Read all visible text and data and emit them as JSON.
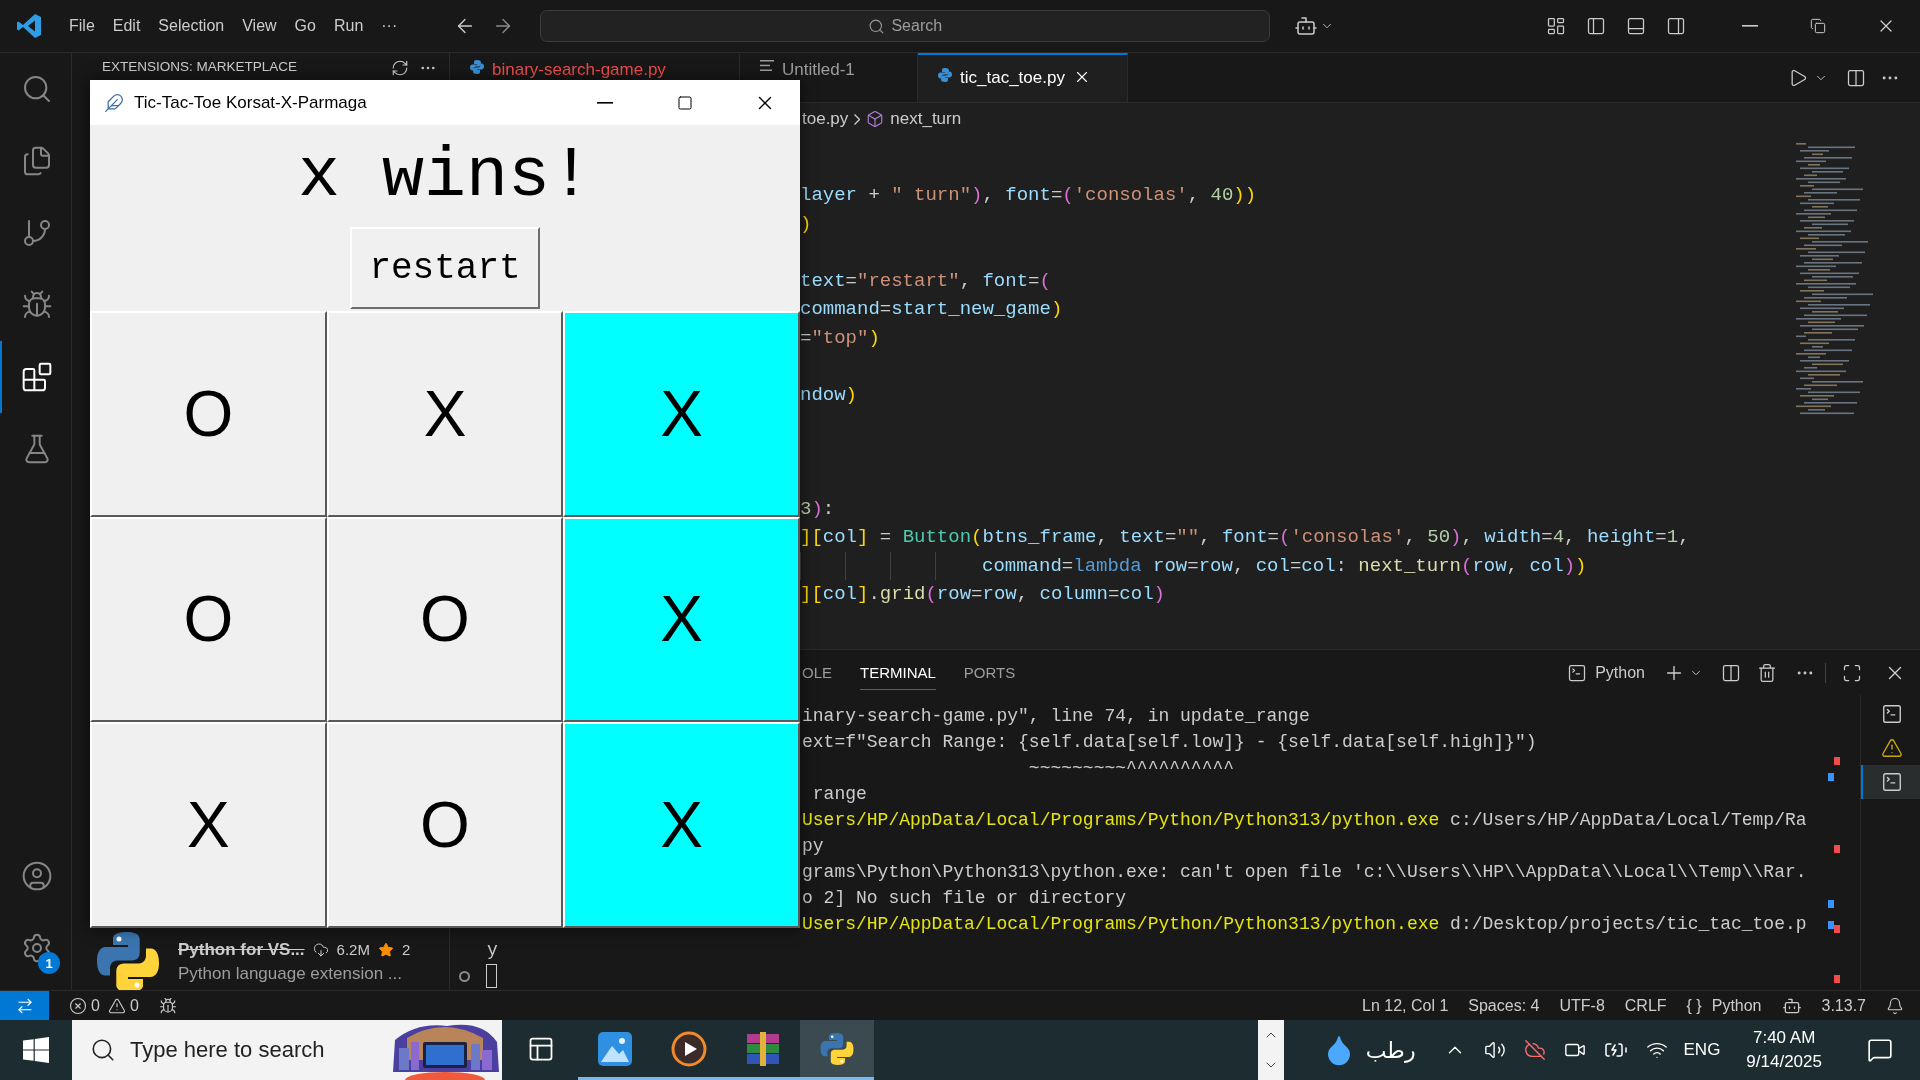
{
  "titlebar": {
    "menus": [
      "File",
      "Edit",
      "Selection",
      "View",
      "Go",
      "Run",
      "···"
    ],
    "search": {
      "placeholder": "Search"
    }
  },
  "activity_bar": {
    "items": [
      {
        "kind": "search",
        "selected": false
      },
      {
        "kind": "explorer",
        "selected": false
      },
      {
        "kind": "source-control",
        "selected": false
      },
      {
        "kind": "run",
        "selected": false
      },
      {
        "kind": "extensions",
        "selected": true
      },
      {
        "kind": "testing",
        "selected": false
      }
    ],
    "settings_badge": "1"
  },
  "sidebar": {
    "title": "EXTENSIONS: MARKETPLACE",
    "extension": {
      "name": "Python for VS...",
      "deprecated": true,
      "downloads": "6.2M",
      "rating": "2",
      "description": "Python language extension ..."
    }
  },
  "editor": {
    "tabs": [
      {
        "label": "binary-search-game.py",
        "kind": "python",
        "error": true,
        "selected": false
      },
      {
        "label": "Untitled-1",
        "kind": "text",
        "error": false,
        "selected": false
      },
      {
        "label": "tic_tac_toe.py",
        "kind": "python",
        "error": false,
        "selected": true
      }
    ],
    "breadcrumb": {
      "file": "toe.py",
      "symbol": "next_turn"
    },
    "code": [
      {
        "kind": "code",
        "tokens": [
          {
            "text": "layer",
            "kind": "id"
          },
          {
            "text": " + ",
            "kind": "op"
          },
          {
            "text": "\" turn\"",
            "kind": "str"
          },
          {
            "text": ")",
            "kind": "br2"
          },
          {
            "text": ", ",
            "kind": "op"
          },
          {
            "text": "font",
            "kind": "id"
          },
          {
            "text": "=",
            "kind": "op"
          },
          {
            "text": "(",
            "kind": "br2"
          },
          {
            "text": "'consolas'",
            "kind": "str"
          },
          {
            "text": ", ",
            "kind": "op"
          },
          {
            "text": "40",
            "kind": "num"
          },
          {
            "text": "))",
            "kind": "br1"
          }
        ]
      },
      {
        "kind": "code",
        "tokens": [
          {
            "text": ")",
            "kind": "br1"
          }
        ]
      },
      {
        "kind": "blank"
      },
      {
        "kind": "code",
        "tokens": [
          {
            "text": "text",
            "kind": "id"
          },
          {
            "text": "=",
            "kind": "op"
          },
          {
            "text": "\"restart\"",
            "kind": "str"
          },
          {
            "text": ", ",
            "kind": "op"
          },
          {
            "text": "font",
            "kind": "id"
          },
          {
            "text": "=",
            "kind": "op"
          },
          {
            "text": "(",
            "kind": "br2"
          }
        ]
      },
      {
        "kind": "code",
        "tokens": [
          {
            "text": "command",
            "kind": "id"
          },
          {
            "text": "=",
            "kind": "op"
          },
          {
            "text": "start_new_game",
            "kind": "id"
          },
          {
            "text": ")",
            "kind": "br1"
          }
        ]
      },
      {
        "kind": "code",
        "tokens": [
          {
            "text": "=",
            "kind": "op"
          },
          {
            "text": "\"top\"",
            "kind": "str"
          },
          {
            "text": ")",
            "kind": "br1"
          }
        ]
      },
      {
        "kind": "blank"
      },
      {
        "kind": "code",
        "tokens": [
          {
            "text": "ndow",
            "kind": "id"
          },
          {
            "text": ")",
            "kind": "br1"
          }
        ]
      },
      {
        "kind": "blank"
      },
      {
        "kind": "blank"
      },
      {
        "kind": "blank"
      },
      {
        "kind": "code",
        "tokens": [
          {
            "text": "3",
            "kind": "num"
          },
          {
            "text": ")",
            "kind": "br2"
          },
          {
            "text": ":",
            "kind": "op"
          }
        ]
      },
      {
        "kind": "code",
        "tokens": [
          {
            "text": "][",
            "kind": "br1"
          },
          {
            "text": "col",
            "kind": "id"
          },
          {
            "text": "]",
            "kind": "br1"
          },
          {
            "text": " = ",
            "kind": "op"
          },
          {
            "text": "Button",
            "kind": "cls"
          },
          {
            "text": "(",
            "kind": "br1"
          },
          {
            "text": "btns_frame",
            "kind": "id"
          },
          {
            "text": ", ",
            "kind": "op"
          },
          {
            "text": "text",
            "kind": "id"
          },
          {
            "text": "=",
            "kind": "op"
          },
          {
            "text": "\"\"",
            "kind": "str"
          },
          {
            "text": ", ",
            "kind": "op"
          },
          {
            "text": "font",
            "kind": "id"
          },
          {
            "text": "=",
            "kind": "op"
          },
          {
            "text": "(",
            "kind": "br2"
          },
          {
            "text": "'consolas'",
            "kind": "str"
          },
          {
            "text": ", ",
            "kind": "op"
          },
          {
            "text": "50",
            "kind": "num"
          },
          {
            "text": ")",
            "kind": "br2"
          },
          {
            "text": ", ",
            "kind": "op"
          },
          {
            "text": "width",
            "kind": "id"
          },
          {
            "text": "=",
            "kind": "op"
          },
          {
            "text": "4",
            "kind": "num"
          },
          {
            "text": ", ",
            "kind": "op"
          },
          {
            "text": "height",
            "kind": "id"
          },
          {
            "text": "=",
            "kind": "op"
          },
          {
            "text": "1",
            "kind": "num"
          },
          {
            "text": ",",
            "kind": "op"
          }
        ]
      },
      {
        "kind": "indented",
        "tokens": [
          {
            "text": "command",
            "kind": "id"
          },
          {
            "text": "=",
            "kind": "op"
          },
          {
            "text": "lambda",
            "kind": "kw"
          },
          {
            "text": " row",
            "kind": "id"
          },
          {
            "text": "=",
            "kind": "op"
          },
          {
            "text": "row",
            "kind": "id"
          },
          {
            "text": ", ",
            "kind": "op"
          },
          {
            "text": "col",
            "kind": "id"
          },
          {
            "text": "=",
            "kind": "op"
          },
          {
            "text": "col",
            "kind": "id"
          },
          {
            "text": ": ",
            "kind": "op"
          },
          {
            "text": "next_turn",
            "kind": "fn"
          },
          {
            "text": "(",
            "kind": "br2"
          },
          {
            "text": "row",
            "kind": "id"
          },
          {
            "text": ", ",
            "kind": "op"
          },
          {
            "text": "col",
            "kind": "id"
          },
          {
            "text": ")",
            "kind": "br2"
          },
          {
            "text": ")",
            "kind": "br1"
          }
        ]
      },
      {
        "kind": "code",
        "tokens": [
          {
            "text": "][",
            "kind": "br1"
          },
          {
            "text": "col",
            "kind": "id"
          },
          {
            "text": "]",
            "kind": "br1"
          },
          {
            "text": ".",
            "kind": "op"
          },
          {
            "text": "grid",
            "kind": "fn"
          },
          {
            "text": "(",
            "kind": "br2"
          },
          {
            "text": "row",
            "kind": "id"
          },
          {
            "text": "=",
            "kind": "op"
          },
          {
            "text": "row",
            "kind": "id"
          },
          {
            "text": ", ",
            "kind": "op"
          },
          {
            "text": "column",
            "kind": "id"
          },
          {
            "text": "=",
            "kind": "op"
          },
          {
            "text": "col",
            "kind": "id"
          },
          {
            "text": ")",
            "kind": "br2"
          }
        ]
      }
    ]
  },
  "panel": {
    "tabs": [
      {
        "label": "OLE",
        "selected": false
      },
      {
        "label": "TERMINAL",
        "selected": true
      },
      {
        "label": "PORTS",
        "selected": false
      }
    ],
    "shell": "Python",
    "lines": [
      [
        {
          "text": "inary-search-game.py\", line 74, in update_range",
          "kind": "out"
        }
      ],
      [
        {
          "text": "ext=f\"Search Range: {self.data[self.low]} - {self.data[self.high]}\")",
          "kind": "out"
        }
      ],
      [
        {
          "text": "                     ~~~~~~~~~^^^^^^^^^^",
          "kind": "out"
        }
      ],
      [
        {
          "text": " range",
          "kind": "out"
        }
      ],
      [
        {
          "text": "Users/HP/AppData/Local/Programs/Python/Python313/python.exe",
          "kind": "path"
        },
        {
          "text": " c:/Users/HP/AppData/Local/Temp/Ra",
          "kind": "out"
        }
      ],
      [
        {
          "text": "py",
          "kind": "out"
        }
      ],
      [
        {
          "text": "grams\\Python\\Python313\\python.exe: can't open file 'c:\\\\Users\\\\HP\\\\AppData\\\\Local\\\\Temp\\\\Rar.",
          "kind": "out"
        }
      ],
      [
        {
          "text": "o 2] No such file or directory",
          "kind": "out"
        }
      ],
      [
        {
          "text": "Users/HP/AppData/Local/Programs/Python/Python313/python.exe",
          "kind": "path"
        },
        {
          "text": " d:/Desktop/projects/tic_tac_toe.p",
          "kind": "out"
        }
      ]
    ],
    "wrapped_tail": "y",
    "sessions": [
      {
        "kind": "terminal",
        "selected": false
      },
      {
        "kind": "warning",
        "selected": false
      },
      {
        "kind": "terminal",
        "selected": true
      }
    ]
  },
  "status_bar": {
    "errors": "0",
    "warnings": "0",
    "position": "Ln 12, Col 1",
    "indent": "Spaces: 4",
    "encoding": "UTF-8",
    "eol": "CRLF",
    "language_glyph": "{ }",
    "language": "Python",
    "python_version": "3.13.7"
  },
  "tk_window": {
    "title": "Tic-Tac-Toe Korsat-X-Parmaga",
    "message": "x wins!",
    "restart": "restart",
    "cells": [
      {
        "mark": "O",
        "win": false
      },
      {
        "mark": "X",
        "win": false
      },
      {
        "mark": "X",
        "win": true
      },
      {
        "mark": "O",
        "win": false
      },
      {
        "mark": "O",
        "win": false
      },
      {
        "mark": "X",
        "win": true
      },
      {
        "mark": "X",
        "win": false
      },
      {
        "mark": "O",
        "win": false
      },
      {
        "mark": "X",
        "win": true
      }
    ]
  },
  "taskbar": {
    "search_placeholder": "Type here to search",
    "apps": [
      {
        "kind": "photos",
        "running": true,
        "selected": false
      },
      {
        "kind": "media",
        "running": true,
        "selected": false
      },
      {
        "kind": "archive",
        "running": true,
        "selected": false
      },
      {
        "kind": "python",
        "running": true,
        "selected": true
      }
    ],
    "weather": "رطب",
    "language": "ENG",
    "time": "7:40 AM",
    "date": "9/14/2025"
  }
}
